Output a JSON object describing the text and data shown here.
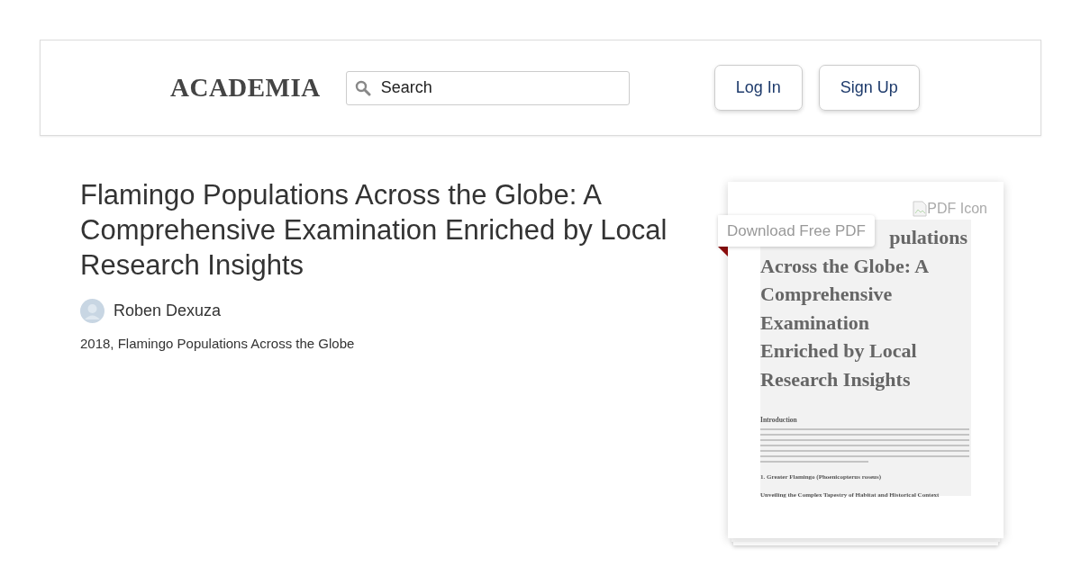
{
  "header": {
    "logo": "ACADEMIA",
    "search": {
      "placeholder": "Search"
    },
    "buttons": [
      "Log In",
      "Sign Up"
    ]
  },
  "paper": {
    "title": "Flamingo Populations Across the Globe: A Comprehensive Examination Enriched by Local Research Insights",
    "author": "Roben Dexuza",
    "meta": "2018, Flamingo Populations Across the Globe"
  },
  "preview": {
    "download_label": "Download Free PDF",
    "icon_alt": "PDF Icon",
    "title_lines": [
      "pulations",
      "Across the Globe: A",
      "Comprehensive",
      "Examination",
      "Enriched by Local",
      "Research Insights"
    ],
    "section_heading": "Introduction",
    "heading": "1. Greater Flamingo (Phoenicopterus roseus)",
    "subheading": "Unveiling the Complex Tapestry of Habitat and Historical Context"
  }
}
